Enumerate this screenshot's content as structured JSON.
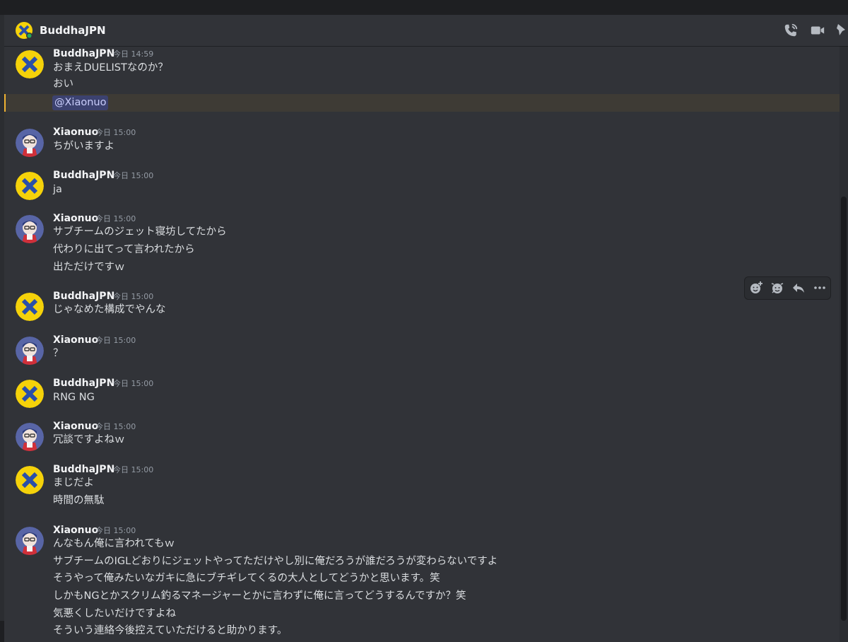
{
  "header": {
    "title": "BuddhaJPN",
    "icons": [
      "phone-call-icon",
      "video-camera-icon",
      "pin-icon"
    ]
  },
  "mention": "@Xiaonuo",
  "messages": [
    {
      "author": "BuddhaJPN",
      "time": "今日 14:59",
      "lines": [
        "おまえDUELISTなのか？",
        "おい"
      ]
    },
    {
      "author": "Xiaonuo",
      "time": "今日 15:00",
      "lines": [
        "ちがいますよ"
      ]
    },
    {
      "author": "BuddhaJPN",
      "time": "今日 15:00",
      "lines": [
        "ja"
      ]
    },
    {
      "author": "Xiaonuo",
      "time": "今日 15:00",
      "lines": [
        "サブチームのジェット寝坊してたから",
        "代わりに出てって言われたから",
        "出ただけですｗ"
      ]
    },
    {
      "author": "BuddhaJPN",
      "time": "今日 15:00",
      "lines": [
        "じゃなめた構成でやんな"
      ]
    },
    {
      "author": "Xiaonuo",
      "time": "今日 15:00",
      "lines": [
        "？"
      ]
    },
    {
      "author": "BuddhaJPN",
      "time": "今日 15:00",
      "lines": [
        "RNG NG"
      ]
    },
    {
      "author": "Xiaonuo",
      "time": "今日 15:00",
      "lines": [
        "冗談ですよねｗ"
      ]
    },
    {
      "author": "BuddhaJPN",
      "time": "今日 15:00",
      "lines": [
        "まじだよ",
        "時間の無駄"
      ]
    },
    {
      "author": "Xiaonuo",
      "time": "今日 15:00",
      "lines": [
        "んなもん俺に言われてもｗ",
        "サブチームのIGLどおりにジェットやってただけやし別に俺だろうが誰だろうが変わらないですよ",
        "そうやって俺みたいなガキに急にブチギレてくるの大人としてどうかと思います。笑",
        "しかもNGとかスクリム釣るマネージャーとかに言わずに俺に言ってどうするんですか？笑",
        "気悪くしたいだけですよね",
        "そういう連絡今後控えていただけると助かります。"
      ]
    }
  ],
  "hover_toolbar": [
    "add-reaction-icon",
    "super-reaction-icon",
    "reply-icon",
    "more-options-icon"
  ],
  "colors": {
    "background": "#313338",
    "mention_highlight": "#f0b232",
    "buddha_avatar": "#f5d20a",
    "xiaonuo_avatar": "#5865a6"
  }
}
